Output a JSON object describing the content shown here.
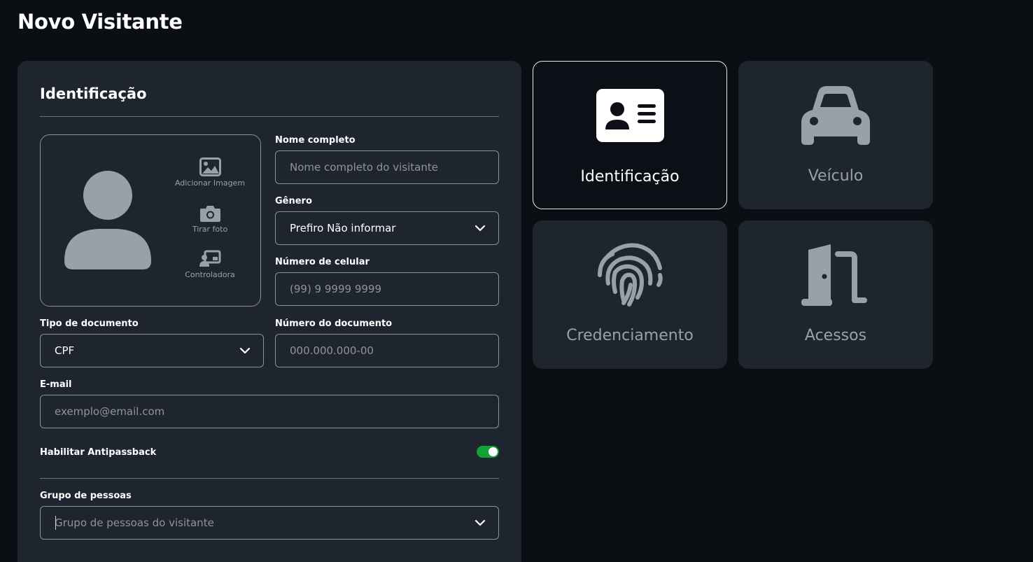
{
  "page": {
    "title": "Novo Visitante"
  },
  "section": {
    "title": "Identificação"
  },
  "photo_actions": {
    "add_image": "Adicionar Imagem",
    "take_photo": "Tirar foto",
    "controller": "Controladora"
  },
  "form": {
    "full_name": {
      "label": "Nome completo",
      "placeholder": "Nome completo do visitante"
    },
    "gender": {
      "label": "Gênero",
      "value": "Prefiro Não informar"
    },
    "phone": {
      "label": "Número de celular",
      "placeholder": "(99) 9 9999 9999"
    },
    "doc_type": {
      "label": "Tipo de documento",
      "value": "CPF"
    },
    "doc_number": {
      "label": "Número do documento",
      "placeholder": "000.000.000-00"
    },
    "email": {
      "label": "E-mail",
      "placeholder": "exemplo@email.com"
    },
    "antipassback": {
      "label": "Habilitar Antipassback",
      "enabled": true
    },
    "people_group": {
      "label": "Grupo de pessoas",
      "placeholder": "Grupo de pessoas do visitante"
    }
  },
  "tiles": {
    "identification": {
      "label": "Identificação",
      "icon": "id-card-icon",
      "active": true
    },
    "vehicle": {
      "label": "Veículo",
      "icon": "car-icon",
      "active": false
    },
    "credentialing": {
      "label": "Credenciamento",
      "icon": "fingerprint-icon",
      "active": false
    },
    "access": {
      "label": "Acessos",
      "icon": "door-open-icon",
      "active": false
    }
  },
  "colors": {
    "background": "#0b0e13",
    "panel": "#1f252f",
    "toggle_on": "#13a23a",
    "muted_icon": "#9aa0a8"
  }
}
